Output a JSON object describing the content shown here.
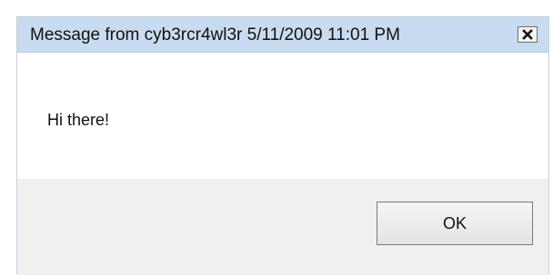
{
  "window": {
    "title": "Message from cyb3rcr4wl3r 5/11/2009 11:01 PM",
    "close_icon": "close-x-icon"
  },
  "message": {
    "text": "Hi there!"
  },
  "buttons": {
    "ok_label": "OK"
  },
  "colors": {
    "titlebar": "#c9dbf0",
    "footer": "#f0f0f0",
    "content": "#ffffff"
  }
}
